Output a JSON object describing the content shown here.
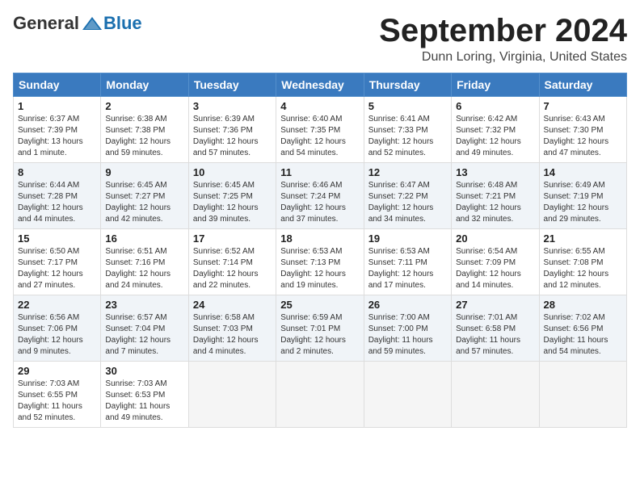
{
  "header": {
    "logo_general": "General",
    "logo_blue": "Blue",
    "month": "September 2024",
    "location": "Dunn Loring, Virginia, United States"
  },
  "weekdays": [
    "Sunday",
    "Monday",
    "Tuesday",
    "Wednesday",
    "Thursday",
    "Friday",
    "Saturday"
  ],
  "weeks": [
    [
      {
        "day": "1",
        "sunrise": "Sunrise: 6:37 AM",
        "sunset": "Sunset: 7:39 PM",
        "daylight": "Daylight: 13 hours and 1 minute."
      },
      {
        "day": "2",
        "sunrise": "Sunrise: 6:38 AM",
        "sunset": "Sunset: 7:38 PM",
        "daylight": "Daylight: 12 hours and 59 minutes."
      },
      {
        "day": "3",
        "sunrise": "Sunrise: 6:39 AM",
        "sunset": "Sunset: 7:36 PM",
        "daylight": "Daylight: 12 hours and 57 minutes."
      },
      {
        "day": "4",
        "sunrise": "Sunrise: 6:40 AM",
        "sunset": "Sunset: 7:35 PM",
        "daylight": "Daylight: 12 hours and 54 minutes."
      },
      {
        "day": "5",
        "sunrise": "Sunrise: 6:41 AM",
        "sunset": "Sunset: 7:33 PM",
        "daylight": "Daylight: 12 hours and 52 minutes."
      },
      {
        "day": "6",
        "sunrise": "Sunrise: 6:42 AM",
        "sunset": "Sunset: 7:32 PM",
        "daylight": "Daylight: 12 hours and 49 minutes."
      },
      {
        "day": "7",
        "sunrise": "Sunrise: 6:43 AM",
        "sunset": "Sunset: 7:30 PM",
        "daylight": "Daylight: 12 hours and 47 minutes."
      }
    ],
    [
      {
        "day": "8",
        "sunrise": "Sunrise: 6:44 AM",
        "sunset": "Sunset: 7:28 PM",
        "daylight": "Daylight: 12 hours and 44 minutes."
      },
      {
        "day": "9",
        "sunrise": "Sunrise: 6:45 AM",
        "sunset": "Sunset: 7:27 PM",
        "daylight": "Daylight: 12 hours and 42 minutes."
      },
      {
        "day": "10",
        "sunrise": "Sunrise: 6:45 AM",
        "sunset": "Sunset: 7:25 PM",
        "daylight": "Daylight: 12 hours and 39 minutes."
      },
      {
        "day": "11",
        "sunrise": "Sunrise: 6:46 AM",
        "sunset": "Sunset: 7:24 PM",
        "daylight": "Daylight: 12 hours and 37 minutes."
      },
      {
        "day": "12",
        "sunrise": "Sunrise: 6:47 AM",
        "sunset": "Sunset: 7:22 PM",
        "daylight": "Daylight: 12 hours and 34 minutes."
      },
      {
        "day": "13",
        "sunrise": "Sunrise: 6:48 AM",
        "sunset": "Sunset: 7:21 PM",
        "daylight": "Daylight: 12 hours and 32 minutes."
      },
      {
        "day": "14",
        "sunrise": "Sunrise: 6:49 AM",
        "sunset": "Sunset: 7:19 PM",
        "daylight": "Daylight: 12 hours and 29 minutes."
      }
    ],
    [
      {
        "day": "15",
        "sunrise": "Sunrise: 6:50 AM",
        "sunset": "Sunset: 7:17 PM",
        "daylight": "Daylight: 12 hours and 27 minutes."
      },
      {
        "day": "16",
        "sunrise": "Sunrise: 6:51 AM",
        "sunset": "Sunset: 7:16 PM",
        "daylight": "Daylight: 12 hours and 24 minutes."
      },
      {
        "day": "17",
        "sunrise": "Sunrise: 6:52 AM",
        "sunset": "Sunset: 7:14 PM",
        "daylight": "Daylight: 12 hours and 22 minutes."
      },
      {
        "day": "18",
        "sunrise": "Sunrise: 6:53 AM",
        "sunset": "Sunset: 7:13 PM",
        "daylight": "Daylight: 12 hours and 19 minutes."
      },
      {
        "day": "19",
        "sunrise": "Sunrise: 6:53 AM",
        "sunset": "Sunset: 7:11 PM",
        "daylight": "Daylight: 12 hours and 17 minutes."
      },
      {
        "day": "20",
        "sunrise": "Sunrise: 6:54 AM",
        "sunset": "Sunset: 7:09 PM",
        "daylight": "Daylight: 12 hours and 14 minutes."
      },
      {
        "day": "21",
        "sunrise": "Sunrise: 6:55 AM",
        "sunset": "Sunset: 7:08 PM",
        "daylight": "Daylight: 12 hours and 12 minutes."
      }
    ],
    [
      {
        "day": "22",
        "sunrise": "Sunrise: 6:56 AM",
        "sunset": "Sunset: 7:06 PM",
        "daylight": "Daylight: 12 hours and 9 minutes."
      },
      {
        "day": "23",
        "sunrise": "Sunrise: 6:57 AM",
        "sunset": "Sunset: 7:04 PM",
        "daylight": "Daylight: 12 hours and 7 minutes."
      },
      {
        "day": "24",
        "sunrise": "Sunrise: 6:58 AM",
        "sunset": "Sunset: 7:03 PM",
        "daylight": "Daylight: 12 hours and 4 minutes."
      },
      {
        "day": "25",
        "sunrise": "Sunrise: 6:59 AM",
        "sunset": "Sunset: 7:01 PM",
        "daylight": "Daylight: 12 hours and 2 minutes."
      },
      {
        "day": "26",
        "sunrise": "Sunrise: 7:00 AM",
        "sunset": "Sunset: 7:00 PM",
        "daylight": "Daylight: 11 hours and 59 minutes."
      },
      {
        "day": "27",
        "sunrise": "Sunrise: 7:01 AM",
        "sunset": "Sunset: 6:58 PM",
        "daylight": "Daylight: 11 hours and 57 minutes."
      },
      {
        "day": "28",
        "sunrise": "Sunrise: 7:02 AM",
        "sunset": "Sunset: 6:56 PM",
        "daylight": "Daylight: 11 hours and 54 minutes."
      }
    ],
    [
      {
        "day": "29",
        "sunrise": "Sunrise: 7:03 AM",
        "sunset": "Sunset: 6:55 PM",
        "daylight": "Daylight: 11 hours and 52 minutes."
      },
      {
        "day": "30",
        "sunrise": "Sunrise: 7:03 AM",
        "sunset": "Sunset: 6:53 PM",
        "daylight": "Daylight: 11 hours and 49 minutes."
      },
      null,
      null,
      null,
      null,
      null
    ]
  ]
}
